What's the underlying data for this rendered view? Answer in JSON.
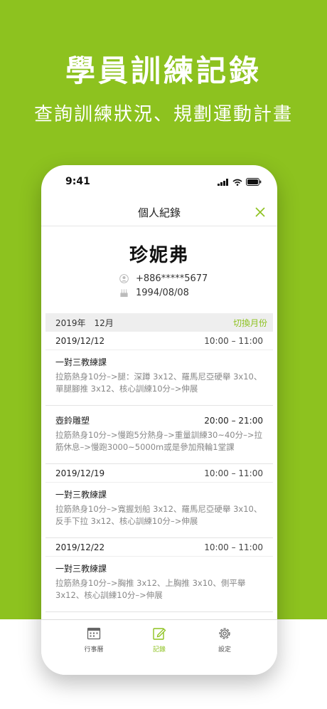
{
  "hero": {
    "title": "學員訓練記錄",
    "subtitle": "查詢訓練狀況、規劃運動計畫"
  },
  "status_bar": {
    "time": "9:41",
    "icons": [
      "signal-icon",
      "wifi-icon",
      "battery-icon"
    ]
  },
  "nav": {
    "title": "個人紀錄",
    "close_icon": "close-icon"
  },
  "profile": {
    "name": "珍妮弗",
    "phone": "+886*****5677",
    "birthday": "1994/08/08",
    "phone_icon": "person-icon",
    "birthday_icon": "cake-icon"
  },
  "month_bar": {
    "label": "2019年　12月",
    "switch_label": "切換月份"
  },
  "records": [
    {
      "date": "2019/12/12",
      "time": "10:00 – 11:00",
      "title": "一對三教練課",
      "desc": "拉筋熱身10分–>腿：深蹲 3x12、羅馬尼亞硬舉 3x10、單腿腳推 3x12、核心訓練10分–>伸展"
    },
    {
      "date": "",
      "time": "20:00 – 21:00",
      "title": "壺鈴雕塑",
      "desc": "拉筋熱身10分–>慢跑5分熱身–>重量訓練30~40分–>拉筋休息–>慢跑3000~5000m或是參加飛輪1堂課"
    },
    {
      "date": "2019/12/19",
      "time": "10:00 – 11:00",
      "title": "一對三教練課",
      "desc": "拉筋熱身10分–>寬握划船 3x12、羅馬尼亞硬舉 3x10、反手下拉 3x12、核心訓練10分–>伸展"
    },
    {
      "date": "2019/12/22",
      "time": "10:00 – 11:00",
      "title": "一對三教練課",
      "desc": "拉筋熱身10分–>胸推 3x12、上胸推 3x10、側平舉 3x12、核心訓練10分–>伸展"
    }
  ],
  "tabs": [
    {
      "label": "行事曆",
      "icon": "calendar-icon",
      "active": false
    },
    {
      "label": "記錄",
      "icon": "edit-icon",
      "active": true
    },
    {
      "label": "設定",
      "icon": "gear-icon",
      "active": false
    }
  ],
  "colors": {
    "brand_green": "#8dc21f",
    "text_dark": "#222222",
    "text_muted": "#888888"
  }
}
